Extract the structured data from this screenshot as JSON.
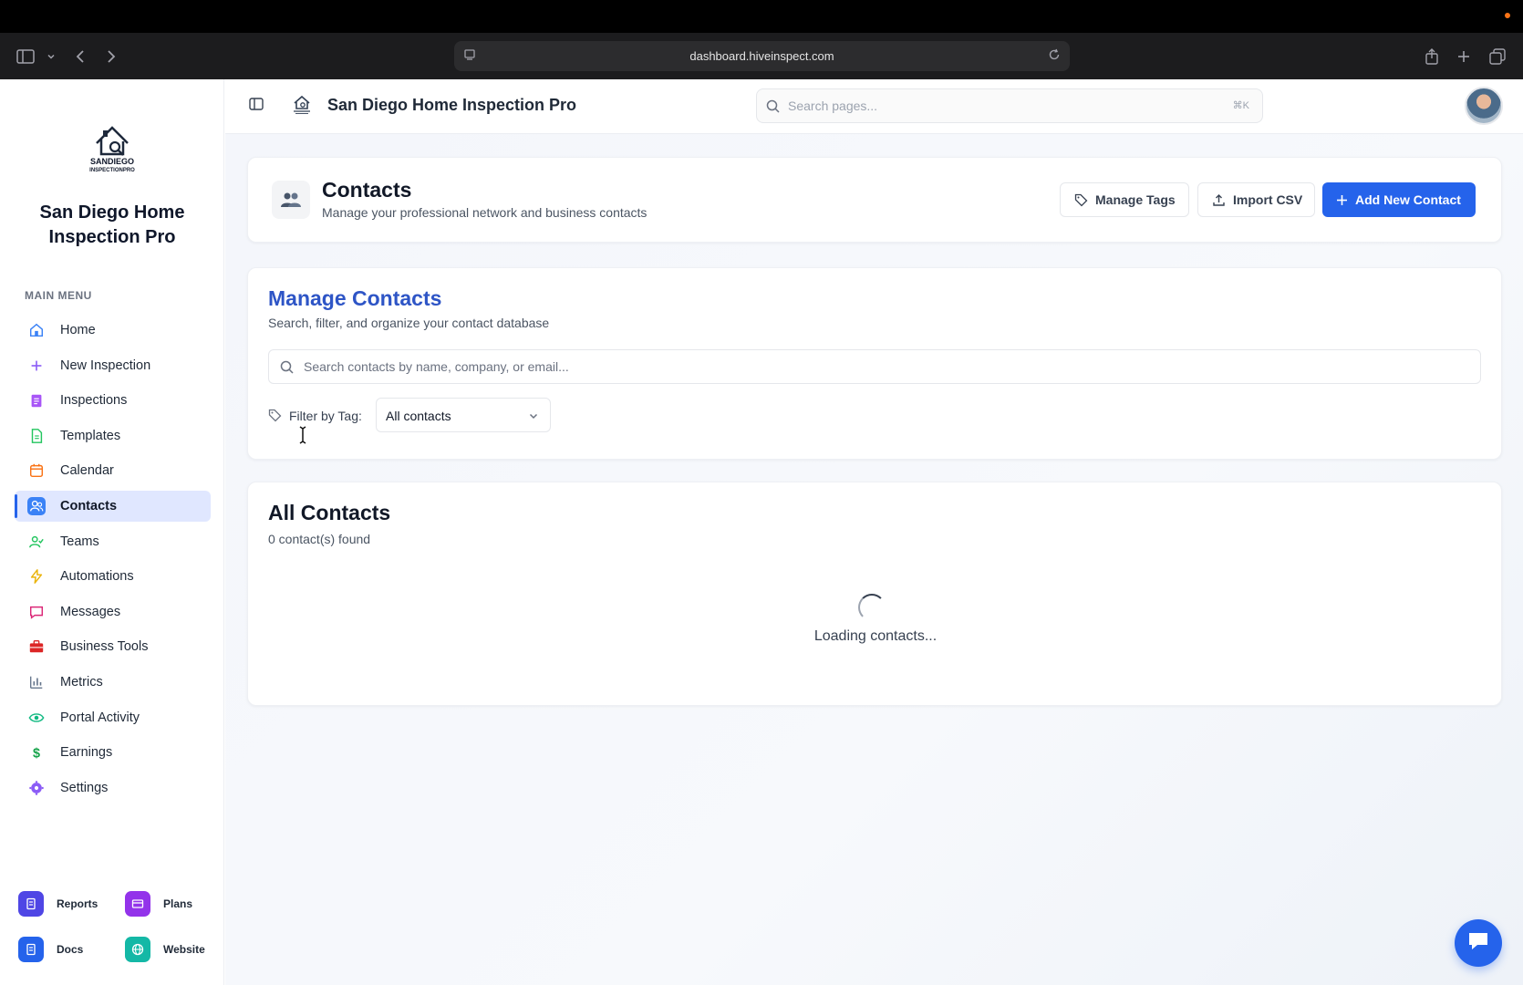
{
  "browser": {
    "url": "dashboard.hiveinspect.com"
  },
  "sidebar": {
    "brand": "San Diego Home Inspection Pro",
    "logo_text": "SANDIEGO INSPECTIONPRO",
    "menu_label": "MAIN MENU",
    "items": [
      {
        "label": "Home",
        "icon": "home-icon",
        "color": "#3b82f6"
      },
      {
        "label": "New Inspection",
        "icon": "plus-icon",
        "color": "#8b5cf6"
      },
      {
        "label": "Inspections",
        "icon": "clipboard-icon",
        "color": "#a855f7"
      },
      {
        "label": "Templates",
        "icon": "document-icon",
        "color": "#22c55e"
      },
      {
        "label": "Calendar",
        "icon": "calendar-icon",
        "color": "#f97316"
      },
      {
        "label": "Contacts",
        "icon": "users-icon",
        "color": "#3b82f6",
        "active": true
      },
      {
        "label": "Teams",
        "icon": "user-check-icon",
        "color": "#22c55e"
      },
      {
        "label": "Automations",
        "icon": "bolt-icon",
        "color": "#eab308"
      },
      {
        "label": "Messages",
        "icon": "message-icon",
        "color": "#db2777"
      },
      {
        "label": "Business Tools",
        "icon": "briefcase-icon",
        "color": "#dc2626"
      },
      {
        "label": "Metrics",
        "icon": "bar-chart-icon",
        "color": "#64748b"
      },
      {
        "label": "Portal Activity",
        "icon": "eye-icon",
        "color": "#10b981"
      },
      {
        "label": "Earnings",
        "icon": "dollar-icon",
        "color": "#16a34a"
      },
      {
        "label": "Settings",
        "icon": "gear-icon",
        "color": "#8b5cf6"
      }
    ],
    "bottom_links": [
      {
        "label": "Reports",
        "icon": "report-icon",
        "color": "#4f46e5"
      },
      {
        "label": "Plans",
        "icon": "credit-card-icon",
        "color": "#9333ea"
      },
      {
        "label": "Docs",
        "icon": "docs-icon",
        "color": "#2563eb"
      },
      {
        "label": "Website",
        "icon": "globe-icon",
        "color": "#14b8a6"
      }
    ]
  },
  "header": {
    "title": "San Diego Home Inspection Pro",
    "search_placeholder": "Search pages...",
    "shortcut": "⌘K"
  },
  "page": {
    "title": "Contacts",
    "subtitle": "Manage your professional network and business contacts",
    "manage_tags_label": "Manage Tags",
    "import_csv_label": "Import CSV",
    "add_contact_label": "Add New Contact"
  },
  "manage": {
    "title": "Manage Contacts",
    "subtitle": "Search, filter, and organize your contact database",
    "search_placeholder": "Search contacts by name, company, or email...",
    "filter_label": "Filter by Tag:",
    "filter_value": "All contacts"
  },
  "all_contacts": {
    "title": "All Contacts",
    "count_text": "0 contact(s) found",
    "loading_text": "Loading contacts..."
  },
  "colors": {
    "accent": "#2563eb",
    "manage_title": "#2e55c6"
  }
}
